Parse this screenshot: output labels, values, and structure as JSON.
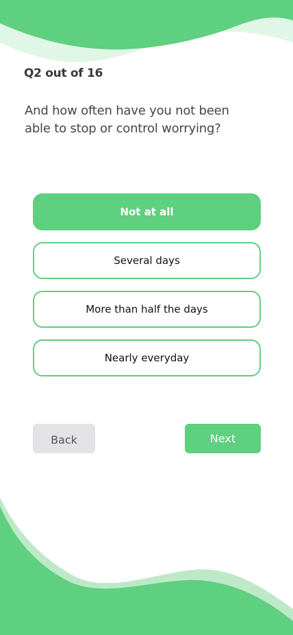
{
  "theme": {
    "accent": "#5fcf80",
    "accent_light": "#e0f6e6",
    "secondary_bg": "#e3e3e6"
  },
  "quiz": {
    "progress_label": "Q2 out of 16",
    "question": "And how often have you not been able to stop or control worrying?",
    "options": [
      {
        "label": "Not at all",
        "selected": true
      },
      {
        "label": "Several days",
        "selected": false
      },
      {
        "label": "More than half the days",
        "selected": false
      },
      {
        "label": "Nearly everyday",
        "selected": false
      }
    ]
  },
  "nav": {
    "back_label": "Back",
    "next_label": "Next"
  }
}
